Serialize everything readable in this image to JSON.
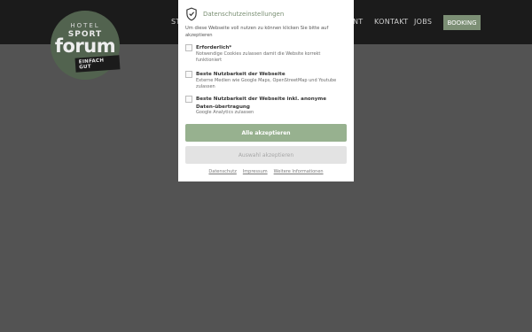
{
  "header": {
    "logo": {
      "hotel": "HOTEL",
      "sport": "SPORT",
      "forum": "forum",
      "tagline": "EINFACH GUT"
    },
    "nav_left_fragment": "ST",
    "nav_right_fragment": "NT",
    "nav_kontakt": "KONTAKT",
    "nav_jobs": "JOBS",
    "booking_label": "BOOKING"
  },
  "modal": {
    "title": "Datenschutzeinstellungen",
    "intro": "Um diese Webseite voll nutzen zu können klicken Sie bitte auf akzeptieren",
    "options": [
      {
        "title": "Erforderlich*",
        "desc": "Notwendige Cookies zulassen damit die Website korrekt funktioniert"
      },
      {
        "title": "Beste Nutzbarkeit der Webseite",
        "desc": "Externe Medien wie Google Maps, OpenStreetMap und Youtube zulassen"
      },
      {
        "title": "Beste Nutzbarkeit der Webseite inkl. anonyme Daten-übertragung",
        "desc": "Google Analytics zulassen"
      }
    ],
    "accept_all_label": "Alle akzeptieren",
    "accept_selection_label": "Auswahl akzeptieren",
    "links": {
      "datenschutz": "Datenschutz",
      "impressum": "Impressum",
      "more_info": "Weitere Informationen"
    }
  },
  "colors": {
    "accent": "#97b18f",
    "header_bg": "#1b1b1b",
    "overlay_bg": "#535353",
    "logo_bg": "#52634f"
  }
}
